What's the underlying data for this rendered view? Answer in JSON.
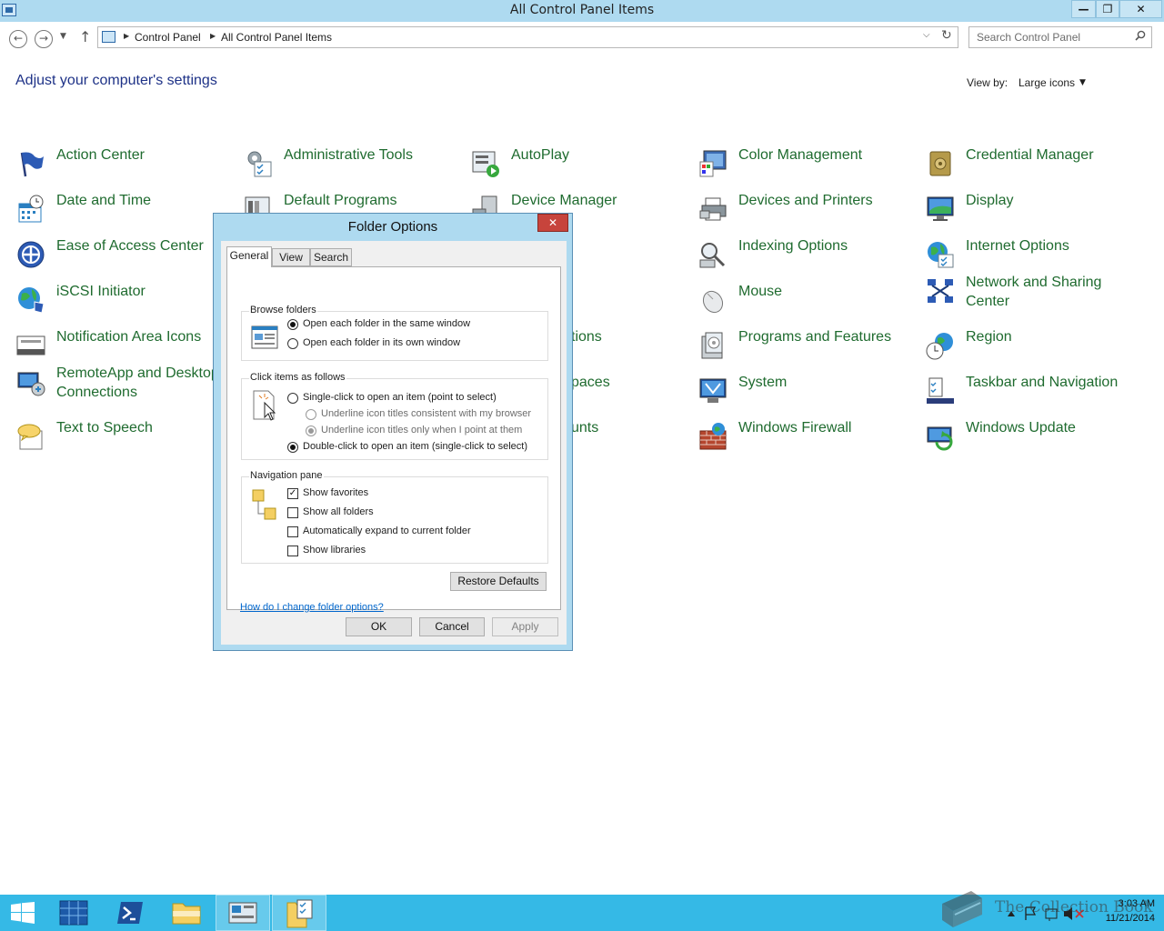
{
  "window": {
    "title": "All Control Panel Items"
  },
  "address_bar": {
    "crumbs": [
      "Control Panel",
      "All Control Panel Items"
    ],
    "search_placeholder": "Search Control Panel"
  },
  "header": {
    "heading": "Adjust your computer's settings",
    "view_by_label": "View by:",
    "view_by_value": "Large icons"
  },
  "items": [
    {
      "label": "Action Center",
      "icon": "flag-icon"
    },
    {
      "label": "Administrative Tools",
      "icon": "gears-icon"
    },
    {
      "label": "AutoPlay",
      "icon": "autoplay-icon"
    },
    {
      "label": "Color Management",
      "icon": "color-management-icon"
    },
    {
      "label": "Credential Manager",
      "icon": "vault-icon"
    },
    {
      "label": "Date and Time",
      "icon": "clock-calendar-icon"
    },
    {
      "label": "Default Programs",
      "icon": "default-programs-icon"
    },
    {
      "label": "Device Manager",
      "icon": "device-manager-icon"
    },
    {
      "label": "Devices and Printers",
      "icon": "printer-icon"
    },
    {
      "label": "Display",
      "icon": "monitor-icon"
    },
    {
      "label": "Ease of Access Center",
      "icon": "accessibility-icon"
    },
    {
      "label": "Indexing Options",
      "icon": "indexing-icon"
    },
    {
      "label": "Internet Options",
      "icon": "globe-icon"
    },
    {
      "label": "iSCSI Initiator",
      "icon": "iscsi-globe-icon"
    },
    {
      "label": "Mouse",
      "icon": "mouse-icon"
    },
    {
      "label": "Network and Sharing Center",
      "icon": "network-icon"
    },
    {
      "label": "Notification Area Icons",
      "icon": "notification-area-icon"
    },
    {
      "label": "tions",
      "icon": ""
    },
    {
      "label": "Programs and Features",
      "icon": "programs-features-icon"
    },
    {
      "label": "Region",
      "icon": "region-icon"
    },
    {
      "label": "RemoteApp and Desktop Connections",
      "icon": "remoteapp-icon"
    },
    {
      "label": "paces",
      "icon": ""
    },
    {
      "label": "System",
      "icon": "system-icon"
    },
    {
      "label": "Taskbar and Navigation",
      "icon": "taskbar-icon"
    },
    {
      "label": "Text to Speech",
      "icon": "speech-bubble-icon"
    },
    {
      "label": "unts",
      "icon": ""
    },
    {
      "label": "Windows Firewall",
      "icon": "firewall-icon"
    },
    {
      "label": "Windows Update",
      "icon": "windows-update-icon"
    }
  ],
  "dialog": {
    "title": "Folder Options",
    "tabs": [
      "General",
      "View",
      "Search"
    ],
    "browse_folders": {
      "title": "Browse folders",
      "options": [
        "Open each folder in the same window",
        "Open each folder in its own window"
      ],
      "selected": 0
    },
    "click_items": {
      "title": "Click items as follows",
      "single_click": "Single-click to open an item (point to select)",
      "underline_browser": "Underline icon titles consistent with my browser",
      "underline_point": "Underline icon titles only when I point at them",
      "double_click": "Double-click to open an item (single-click to select)"
    },
    "navigation_pane": {
      "title": "Navigation pane",
      "checks": [
        {
          "label": "Show favorites",
          "checked": true
        },
        {
          "label": "Show all folders",
          "checked": false
        },
        {
          "label": "Automatically expand to current folder",
          "checked": false
        },
        {
          "label": "Show libraries",
          "checked": false
        }
      ]
    },
    "restore_defaults": "Restore Defaults",
    "help_link": "How do I change folder options?",
    "ok": "OK",
    "cancel": "Cancel",
    "apply": "Apply"
  },
  "taskbar": {
    "time": "3:03 AM",
    "date": "11/21/2014",
    "watermark": "The Collection Book"
  },
  "colors": {
    "link_green": "#1f6b2f",
    "heading_blue": "#1e3287",
    "titlebar": "#aedaf0",
    "taskbar": "#35b9e6"
  }
}
